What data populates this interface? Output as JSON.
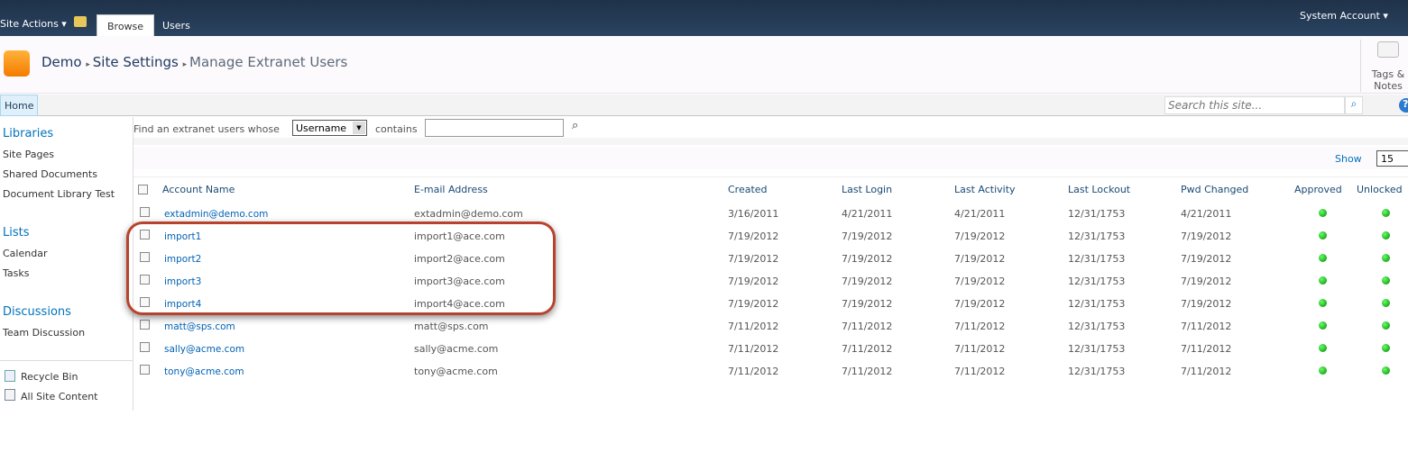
{
  "topbar": {
    "site_actions": "Site Actions",
    "tabs": [
      "Browse",
      "Users"
    ],
    "account": "System Account"
  },
  "breadcrumb": [
    "Demo",
    "Site Settings",
    "Manage Extranet Users"
  ],
  "tags_notes": "Tags & Notes",
  "nav": {
    "home": "Home",
    "search_placeholder": "Search this site..."
  },
  "sidebar": {
    "libraries": "Libraries",
    "library_items": [
      "Site Pages",
      "Shared Documents",
      "Document Library Test"
    ],
    "lists": "Lists",
    "list_items": [
      "Calendar",
      "Tasks"
    ],
    "discussions": "Discussions",
    "discussion_items": [
      "Team Discussion"
    ],
    "recycle_bin": "Recycle Bin",
    "all_site_content": "All Site Content"
  },
  "filter": {
    "label": "Find an extranet users whose",
    "field": "Username",
    "contains": "contains",
    "value": ""
  },
  "paging": {
    "show": "Show",
    "count": "15"
  },
  "table": {
    "headers": [
      "Account Name",
      "E-mail Address",
      "Created",
      "Last Login",
      "Last Activity",
      "Last Lockout",
      "Pwd Changed",
      "Approved",
      "Unlocked"
    ],
    "rows": [
      [
        "extadmin@demo.com",
        "extadmin@demo.com",
        "3/16/2011",
        "4/21/2011",
        "4/21/2011",
        "12/31/1753",
        "4/21/2011"
      ],
      [
        "import1",
        "import1@ace.com",
        "7/19/2012",
        "7/19/2012",
        "7/19/2012",
        "12/31/1753",
        "7/19/2012"
      ],
      [
        "import2",
        "import2@ace.com",
        "7/19/2012",
        "7/19/2012",
        "7/19/2012",
        "12/31/1753",
        "7/19/2012"
      ],
      [
        "import3",
        "import3@ace.com",
        "7/19/2012",
        "7/19/2012",
        "7/19/2012",
        "12/31/1753",
        "7/19/2012"
      ],
      [
        "import4",
        "import4@ace.com",
        "7/19/2012",
        "7/19/2012",
        "7/19/2012",
        "12/31/1753",
        "7/19/2012"
      ],
      [
        "matt@sps.com",
        "matt@sps.com",
        "7/11/2012",
        "7/11/2012",
        "7/11/2012",
        "12/31/1753",
        "7/11/2012"
      ],
      [
        "sally@acme.com",
        "sally@acme.com",
        "7/11/2012",
        "7/11/2012",
        "7/11/2012",
        "12/31/1753",
        "7/11/2012"
      ],
      [
        "tony@acme.com",
        "tony@acme.com",
        "7/11/2012",
        "7/11/2012",
        "7/11/2012",
        "12/31/1753",
        "7/11/2012"
      ]
    ]
  },
  "colors": {
    "highlight": "#b8432c",
    "status_ok": "#1a9a1a"
  }
}
